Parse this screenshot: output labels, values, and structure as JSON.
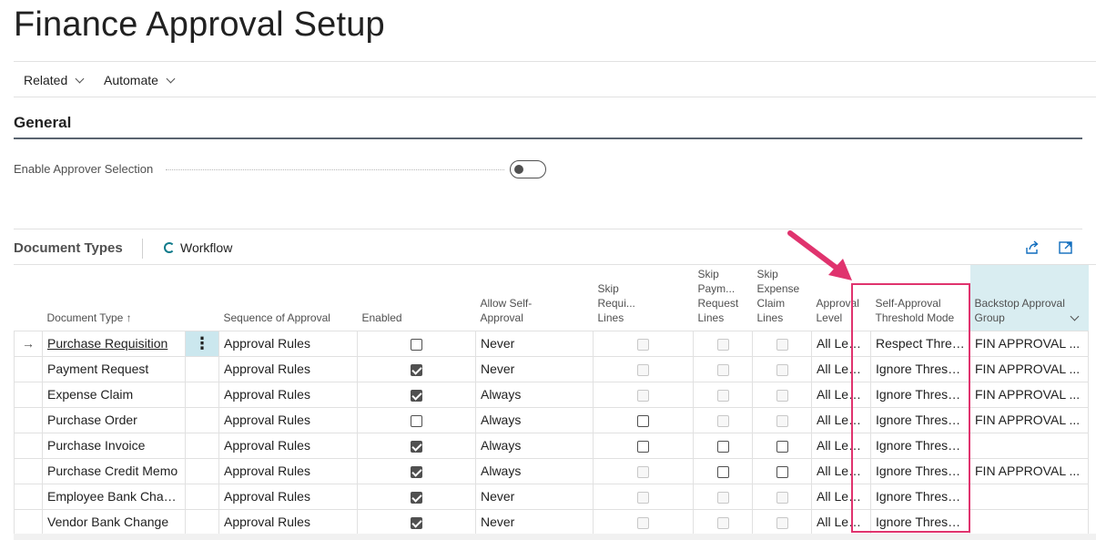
{
  "page": {
    "title": "Finance Approval Setup"
  },
  "actions": [
    {
      "label": "Related"
    },
    {
      "label": "Automate"
    }
  ],
  "general": {
    "title": "General",
    "enable_approver_selection": {
      "label": "Enable Approver Selection",
      "value": false
    }
  },
  "document_types": {
    "title": "Document Types",
    "workflow_label": "Workflow",
    "icons": [
      "share-icon",
      "expand-icon"
    ],
    "columns": {
      "document_type": "Document Type",
      "sort": "↑",
      "sequence": "Sequence of Approval",
      "enabled": "Enabled",
      "allow_self_1": "Allow Self-",
      "allow_self_2": "Approval",
      "skip_req_1": "Skip",
      "skip_req_2": "Requi...",
      "skip_req_3": "Lines",
      "skip_pay_1": "Skip",
      "skip_pay_2": "Paym...",
      "skip_pay_3": "Request",
      "skip_pay_4": "Lines",
      "skip_exp_1": "Skip",
      "skip_exp_2": "Expense",
      "skip_exp_3": "Claim",
      "skip_exp_4": "Lines",
      "approval_level": "Approval Level",
      "threshold_1": "Self-Approval",
      "threshold_2": "Threshold Mode",
      "backstop_1": "Backstop Approval",
      "backstop_2": "Group"
    },
    "rows": [
      {
        "document_type": "Purchase Requisition",
        "sequence": "Approval Rules",
        "enabled": false,
        "allow_self": "Never",
        "skip_req": "disabled",
        "skip_pay": "disabled",
        "skip_exp": "disabled",
        "approval_level": "All Levels App...",
        "threshold": "Respect Threshold",
        "backstop": "FIN APPROVAL ..."
      },
      {
        "document_type": "Payment Request",
        "sequence": "Approval Rules",
        "enabled": true,
        "allow_self": "Never",
        "skip_req": "disabled",
        "skip_pay": "disabled",
        "skip_exp": "disabled",
        "approval_level": "All Levels App...",
        "threshold": "Ignore Threshold",
        "backstop": "FIN APPROVAL ..."
      },
      {
        "document_type": "Expense Claim",
        "sequence": "Approval Rules",
        "enabled": true,
        "allow_self": "Always",
        "skip_req": "disabled",
        "skip_pay": "disabled",
        "skip_exp": "disabled",
        "approval_level": "All Levels App...",
        "threshold": "Ignore Threshold",
        "backstop": "FIN APPROVAL ..."
      },
      {
        "document_type": "Purchase Order",
        "sequence": "Approval Rules",
        "enabled": false,
        "allow_self": "Always",
        "skip_req": "unchecked",
        "skip_pay": "disabled",
        "skip_exp": "disabled",
        "approval_level": "All Levels App...",
        "threshold": "Ignore Threshold",
        "backstop": "FIN APPROVAL ..."
      },
      {
        "document_type": "Purchase Invoice",
        "sequence": "Approval Rules",
        "enabled": true,
        "allow_self": "Always",
        "skip_req": "unchecked",
        "skip_pay": "unchecked",
        "skip_exp": "unchecked",
        "approval_level": "All Levels App...",
        "threshold": "Ignore Threshold",
        "backstop": ""
      },
      {
        "document_type": "Purchase Credit Memo",
        "sequence": "Approval Rules",
        "enabled": true,
        "allow_self": "Always",
        "skip_req": "disabled",
        "skip_pay": "unchecked",
        "skip_exp": "unchecked",
        "approval_level": "All Levels App...",
        "threshold": "Ignore Threshold",
        "backstop": "FIN APPROVAL ..."
      },
      {
        "document_type": "Employee Bank Change",
        "sequence": "Approval Rules",
        "enabled": true,
        "allow_self": "Never",
        "skip_req": "disabled",
        "skip_pay": "disabled",
        "skip_exp": "disabled",
        "approval_level": "All Levels App...",
        "threshold": "Ignore Threshold",
        "backstop": ""
      },
      {
        "document_type": "Vendor Bank Change",
        "sequence": "Approval Rules",
        "enabled": true,
        "allow_self": "Never",
        "skip_req": "disabled",
        "skip_pay": "disabled",
        "skip_exp": "disabled",
        "approval_level": "All Levels App...",
        "threshold": "Ignore Threshold",
        "backstop": ""
      }
    ]
  },
  "annotation": {
    "highlight_color": "#e0336e"
  }
}
